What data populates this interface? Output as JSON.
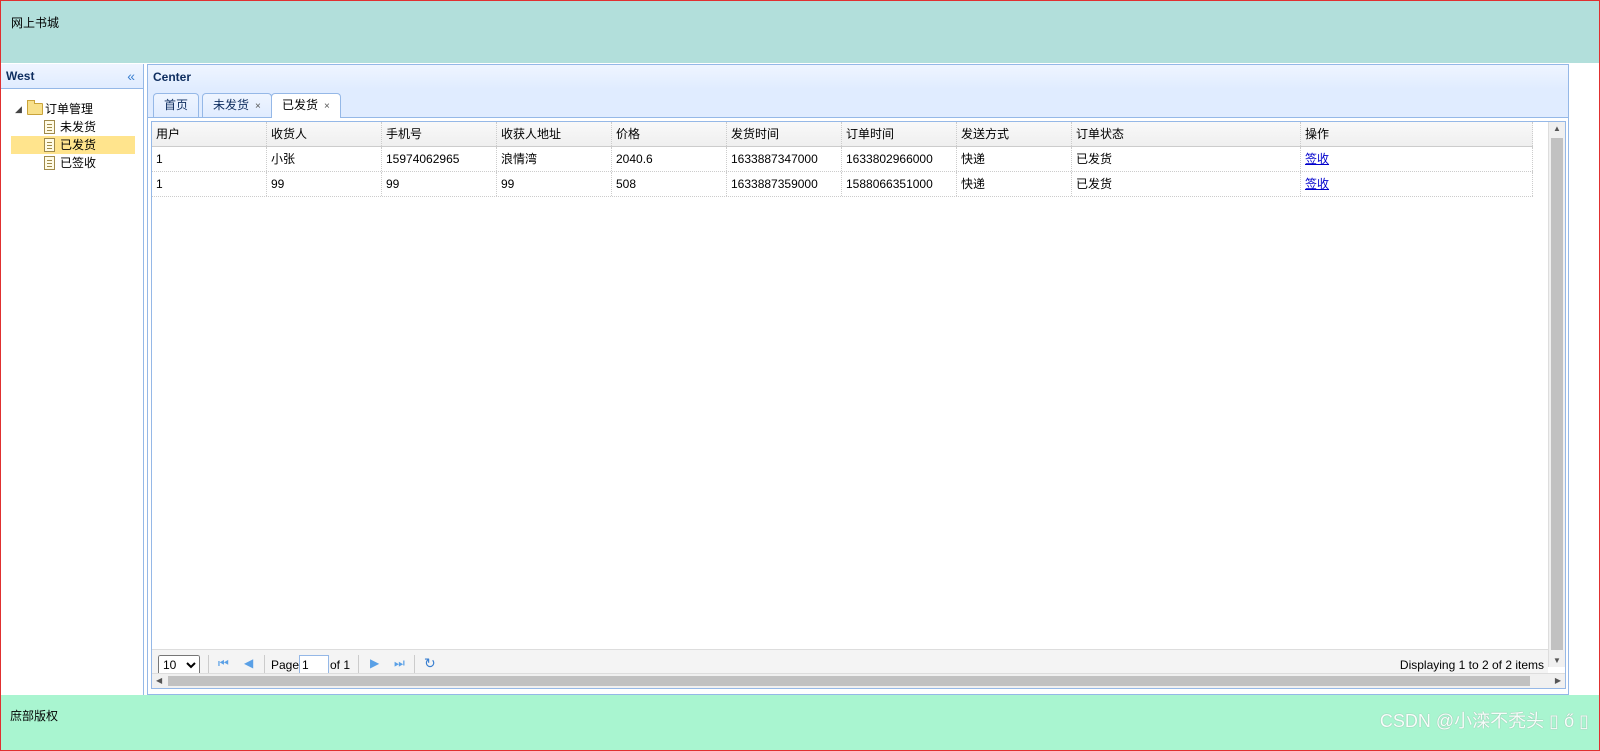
{
  "north": {
    "title": "网上书城"
  },
  "west": {
    "title": "West",
    "collapse_icon": "«",
    "tree": {
      "root": "订单管理",
      "children": [
        {
          "label": "未发货",
          "selected": false
        },
        {
          "label": "已发货",
          "selected": true
        },
        {
          "label": "已签收",
          "selected": false
        }
      ]
    }
  },
  "center": {
    "title": "Center",
    "tabs": [
      {
        "label": "首页",
        "closable": false
      },
      {
        "label": "未发货",
        "closable": true
      },
      {
        "label": "已发货",
        "closable": true,
        "active": true
      }
    ],
    "close_glyph": "×",
    "grid": {
      "columns": [
        "用户",
        "收货人",
        "手机号",
        "收获人地址",
        "价格",
        "发货时间",
        "订单时间",
        "发送方式",
        "订单状态",
        "操作"
      ],
      "rows": [
        [
          "1",
          "小张",
          "15974062965",
          "浪情湾",
          "2040.6",
          "1633887347000",
          "1633802966000",
          "快递",
          "已发货",
          "签收"
        ],
        [
          "1",
          "99",
          "99",
          "99",
          "508",
          "1633887359000",
          "1588066351000",
          "快递",
          "已发货",
          "签收"
        ]
      ]
    },
    "pager": {
      "page_size": "10",
      "page_label": "Page",
      "page_value": "1",
      "of_label": "of 1",
      "display_info": "Displaying 1 to 2 of 2 items"
    }
  },
  "south": {
    "text": "庶部版权"
  },
  "watermark": "CSDN @小滦不秃头 ▯ ő ▯",
  "colors": {
    "north_bg": "#b2dfdb",
    "south_bg": "#a9f5d0",
    "selected_bg": "#ffe48d",
    "border": "#95b8e7"
  }
}
